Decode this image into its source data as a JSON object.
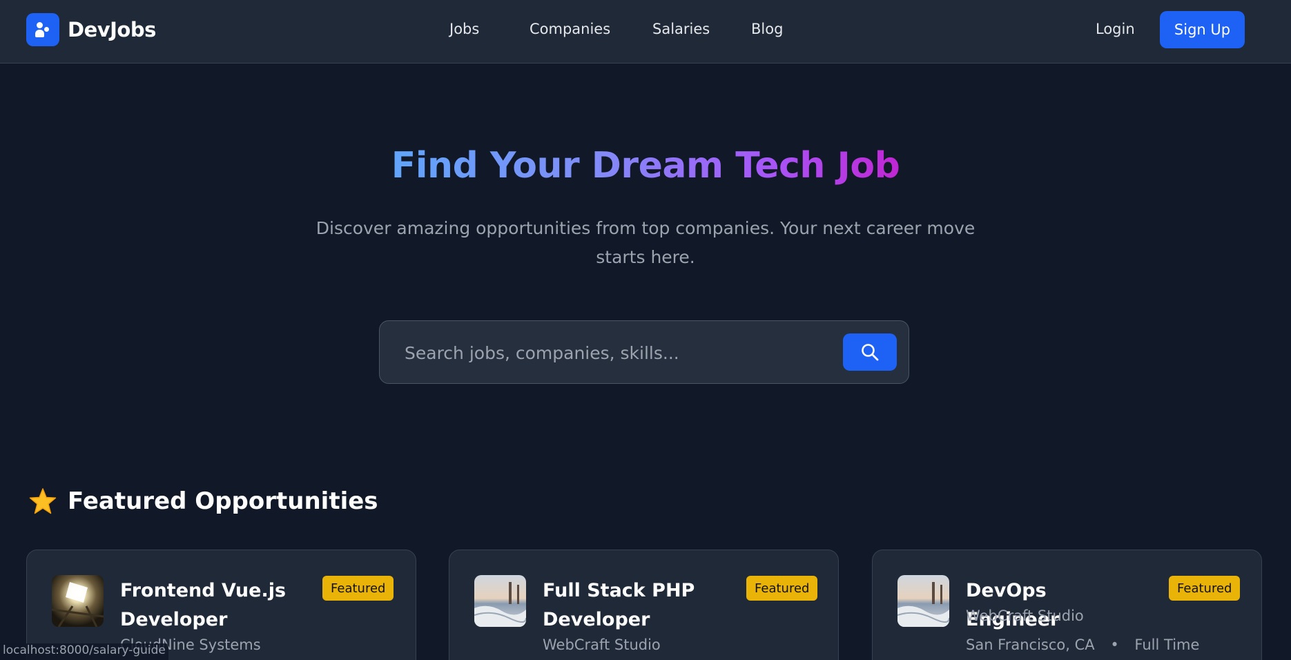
{
  "nav": {
    "brand": "DevJobs",
    "links": [
      "Jobs",
      "Companies",
      "Salaries",
      "Blog"
    ],
    "login_label": "Login",
    "signup_label": "Sign Up"
  },
  "hero": {
    "title": "Find Your Dream Tech Job",
    "subtitle": "Discover amazing opportunities from top companies. Your next career move starts here.",
    "search_placeholder": "Search jobs, companies, skills..."
  },
  "featured": {
    "heading": "Featured Opportunities",
    "cards": [
      {
        "title": "Frontend Vue.js Developer",
        "company": "CloudNine Systems",
        "badge": "Featured"
      },
      {
        "title": "Full Stack PHP Developer",
        "company": "WebCraft Studio",
        "badge": "Featured"
      },
      {
        "title": "DevOps Engineer",
        "company": "WebCraft Studio",
        "location": "San Francisco, CA",
        "type": "Full Time",
        "badge": "Featured"
      }
    ]
  },
  "status_bar": {
    "url": "localhost:8000/salary-guide"
  },
  "colors": {
    "primary": "#1d62f5",
    "background": "#111827",
    "navbar": "#1f2937",
    "badge": "#eab308"
  }
}
